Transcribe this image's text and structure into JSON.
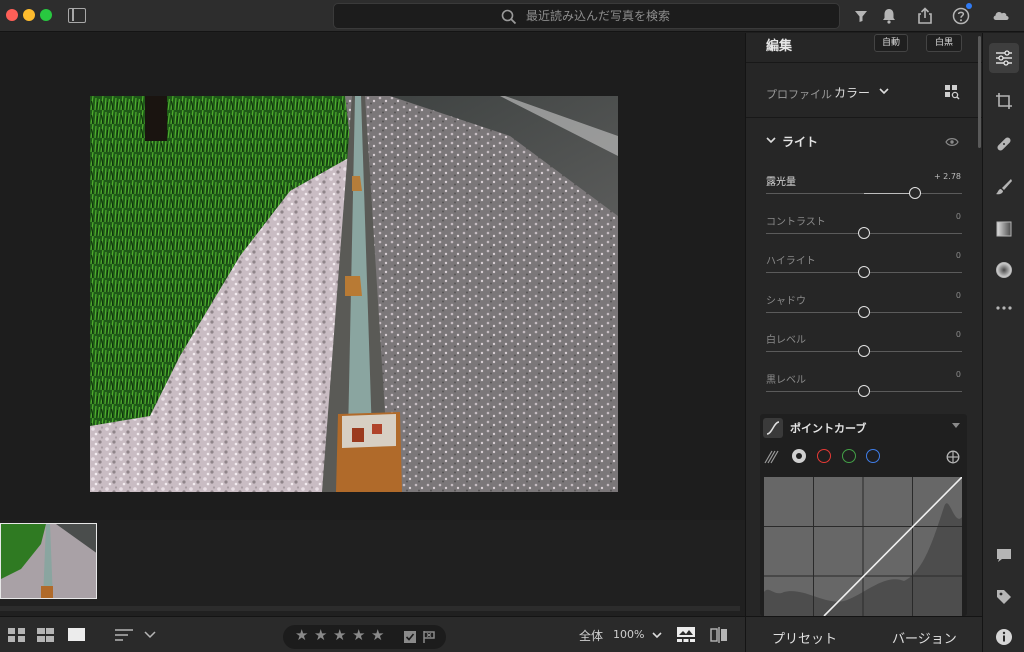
{
  "search": {
    "placeholder": "最近読み込んだ写真を検索"
  },
  "edit_panel": {
    "title": "編集",
    "auto_label": "自動",
    "bw_label": "白黒",
    "profile_label": "プロファイル",
    "profile_value": "カラー",
    "light_section": "ライト",
    "sliders": [
      {
        "label": "露光量",
        "value": "+ 2.78",
        "fraction": 0.76,
        "active": true
      },
      {
        "label": "コントラスト",
        "value": "0",
        "fraction": 0.5,
        "active": false
      },
      {
        "label": "ハイライト",
        "value": "0",
        "fraction": 0.5,
        "active": false
      },
      {
        "label": "シャドウ",
        "value": "0",
        "fraction": 0.5,
        "active": false
      },
      {
        "label": "白レベル",
        "value": "0",
        "fraction": 0.5,
        "active": false
      },
      {
        "label": "黒レベル",
        "value": "0",
        "fraction": 0.5,
        "active": false
      }
    ],
    "point_curve_title": "ポイントカーブ"
  },
  "bottom_bar": {
    "scope_label": "全体",
    "zoom_level": "100%"
  },
  "footer": {
    "presets_label": "プリセット",
    "versions_label": "バージョン"
  },
  "colors": {
    "accent_blue": "#2f7bf5",
    "channel_red": "#e53935",
    "channel_green": "#43a047",
    "channel_blue": "#3f7de8"
  }
}
